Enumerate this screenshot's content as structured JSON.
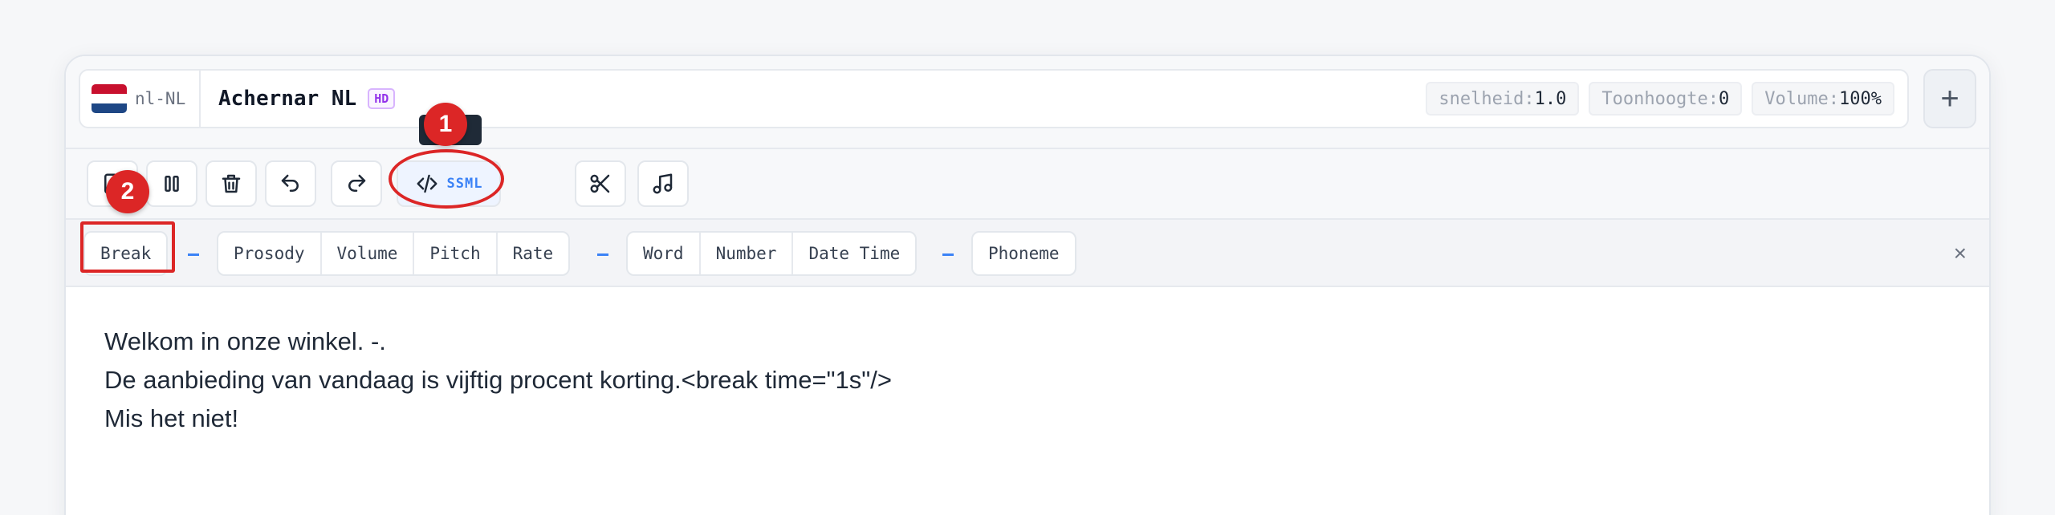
{
  "header": {
    "lang_code": "nl-NL",
    "voice_name": "Achernar NL",
    "voice_badge": "HD",
    "stats": [
      {
        "key": "snelheid:",
        "value": "1.0"
      },
      {
        "key": "Toonhoogte:",
        "value": "0"
      },
      {
        "key": "Volume:",
        "value": "100%"
      }
    ],
    "add_label": "+"
  },
  "toolbar": {
    "ssml_label": "SSML",
    "icons": [
      "import-icon",
      "pause-icon",
      "trash-icon",
      "undo-icon",
      "redo-icon",
      "code-icon",
      "scissors-icon",
      "music-note-icon"
    ]
  },
  "tags": {
    "group1": [
      "Break"
    ],
    "group2": [
      "Prosody",
      "Volume",
      "Pitch",
      "Rate"
    ],
    "group3": [
      "Word",
      "Number",
      "Date Time"
    ],
    "group4": [
      "Phoneme"
    ],
    "close": "×"
  },
  "editor": {
    "lines": [
      "Welkom in onze winkel. -.",
      "De aanbieding van vandaag is vijftig procent korting.<break time=\"1s\"/>",
      "Mis het niet!"
    ]
  },
  "annotations": {
    "badge1": "1",
    "badge2": "2"
  },
  "colors": {
    "accent": "#3b82f6",
    "annotation": "#dc2626",
    "hd_badge": "#9333ea"
  }
}
